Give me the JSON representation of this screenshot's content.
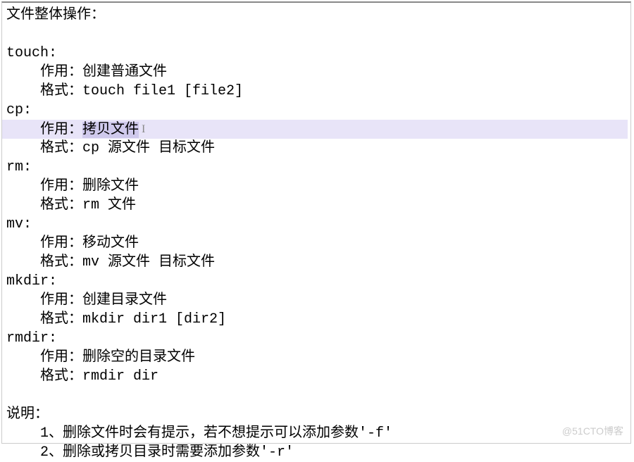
{
  "header": "文件整体操作：",
  "commands": {
    "touch": {
      "name": "touch:",
      "purpose_label": "作用：",
      "purpose": "创建普通文件",
      "format_label": "格式：",
      "format": "touch file1 [file2]"
    },
    "cp": {
      "name": "cp:",
      "purpose_label": "作用：",
      "purpose": "拷贝文件",
      "format_label": "格式：",
      "format": "cp 源文件 目标文件"
    },
    "rm": {
      "name": "rm:",
      "purpose_label": "作用：",
      "purpose": "删除文件",
      "format_label": "格式：",
      "format": "rm 文件"
    },
    "mv": {
      "name": "mv:",
      "purpose_label": "作用：",
      "purpose": "移动文件",
      "format_label": "格式：",
      "format": "mv 源文件 目标文件"
    },
    "mkdir": {
      "name": "mkdir:",
      "purpose_label": "作用：",
      "purpose": "创建目录文件",
      "format_label": "格式：",
      "format": "mkdir dir1 [dir2]"
    },
    "rmdir": {
      "name": "rmdir:",
      "purpose_label": "作用：",
      "purpose": "删除空的目录文件",
      "format_label": "格式：",
      "format": "rmdir dir"
    }
  },
  "notes": {
    "header": "说明：",
    "item1": "1、删除文件时会有提示，若不想提示可以添加参数'-f'",
    "item2": "2、删除或拷贝目录时需要添加参数'-r'"
  },
  "watermark": "@51CTO博客",
  "cursor_glyph": "I",
  "indent1": "    ",
  "indent2": "    "
}
